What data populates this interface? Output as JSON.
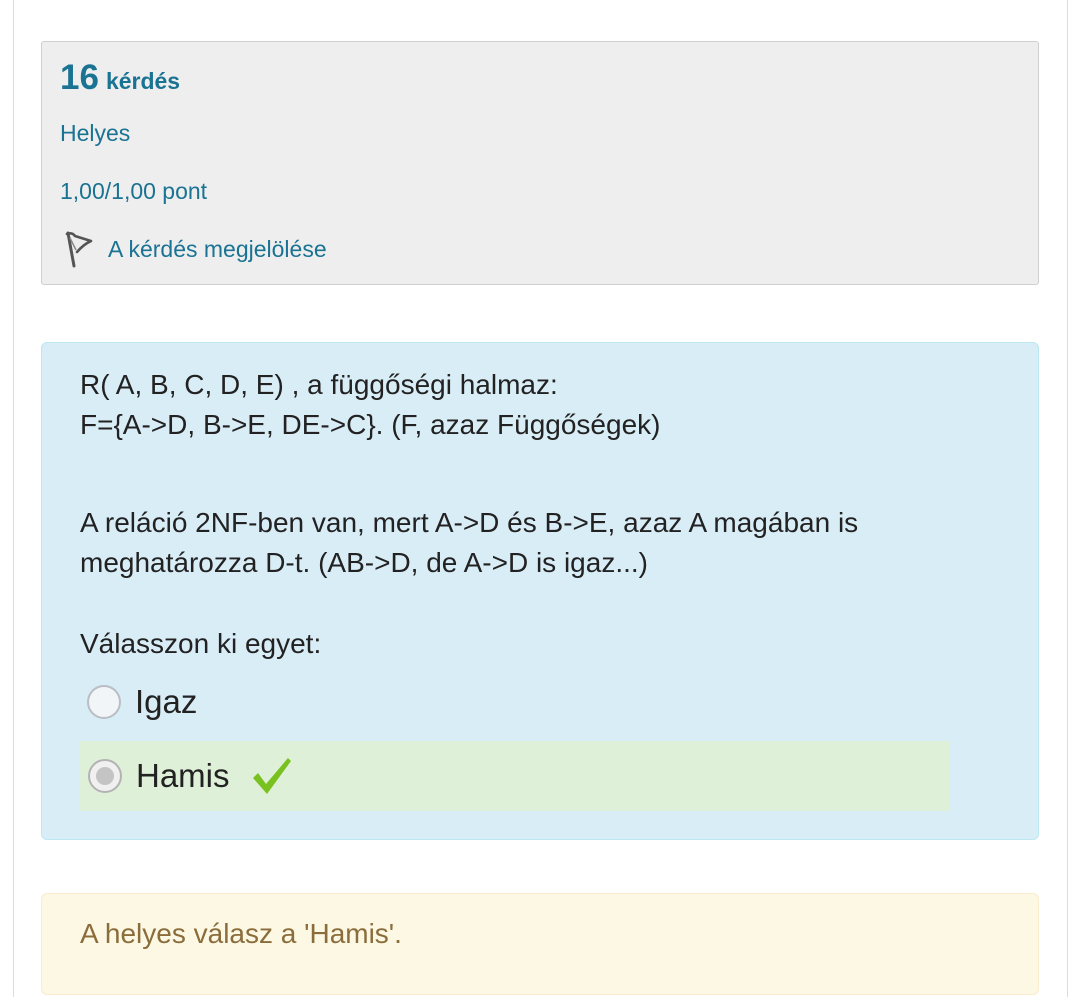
{
  "info": {
    "question_number": "16",
    "question_word": "kérdés",
    "state": "Helyes",
    "grade": "1,00/1,00 pont",
    "flag_label": "A kérdés megjelölése"
  },
  "question": {
    "line1": "R( A, B, C, D, E) , a függőségi halmaz:",
    "line2": "F={A->D, B->E, DE->C}. (F, azaz Függőségek)",
    "line3": "A reláció 2NF-ben van, mert  A->D és B->E, azaz A magában is",
    "line4": "meghatározza D-t. (AB->D, de A->D is igaz...)",
    "prompt": "Válasszon ki egyet:",
    "options": [
      {
        "label": "Igaz",
        "selected": false
      },
      {
        "label": "Hamis",
        "selected": true,
        "correct": true
      }
    ]
  },
  "feedback": {
    "right_answer": "A helyes válasz a 'Hamis'."
  },
  "icons": {
    "flag": "flag-icon",
    "correct": "checkmark-icon"
  },
  "colors": {
    "link_blue": "#1a7392",
    "check_green": "#79c11f",
    "feedback_text": "#8a6d3b"
  }
}
